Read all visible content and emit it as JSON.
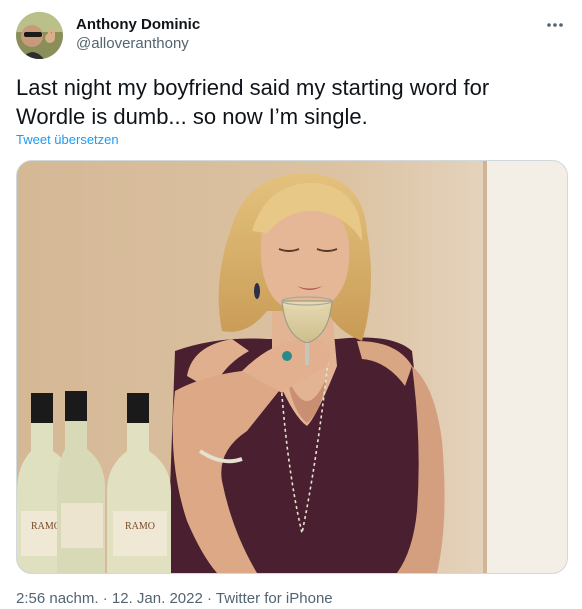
{
  "tweet": {
    "author": {
      "display_name": "Anthony Dominic",
      "handle": "@alloveranthony"
    },
    "text": "Last night my boyfriend said my starting word for\nWordle is dumb... so now I’m single.",
    "translate_label": "Tweet übersetzen",
    "media": {
      "bottle_labels": [
        "RAMO",
        "RAMO",
        "RAMO"
      ]
    },
    "meta": {
      "time": "2:56 nachm.",
      "separator": "·",
      "date": "12. Jan. 2022",
      "source": "Twitter for iPhone"
    },
    "icons": {
      "more": "more-horizontal-icon"
    }
  },
  "colors": {
    "text_primary": "#0f1419",
    "text_secondary": "#536471",
    "link_blue": "#1d9bf0",
    "border": "#cfd9de"
  }
}
